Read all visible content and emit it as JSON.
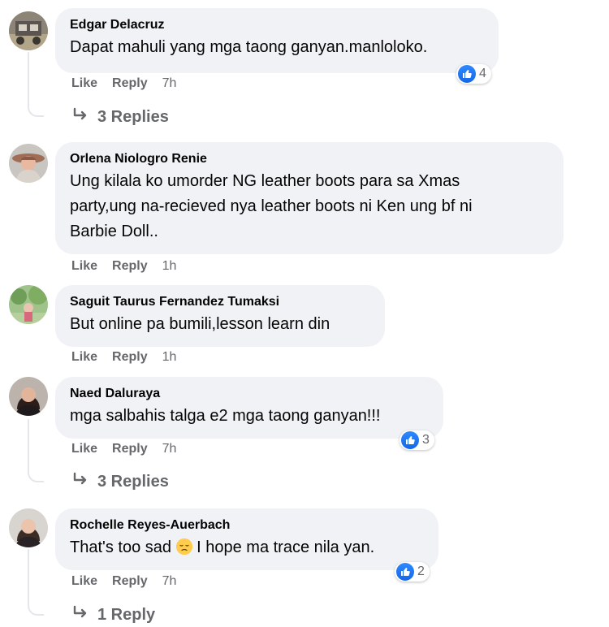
{
  "comments": [
    {
      "author": "Edgar Delacruz",
      "text": "Dapat mahuli yang mga taong ganyan.manloloko.",
      "like": "Like",
      "reply": "Reply",
      "time": "7h",
      "reaction_count": "4",
      "replies_label": "3 Replies"
    },
    {
      "author": "Orlena Niologro Renie",
      "text_lines": [
        "Ung kilala ko umorder NG leather boots para sa Xmas",
        "party,ung na-recieved nya leather boots ni Ken ung bf ni",
        "Barbie Doll.."
      ],
      "like": "Like",
      "reply": "Reply",
      "time": "1h"
    },
    {
      "author": "Saguit Taurus Fernandez Tumaksi",
      "text": "But online pa bumili,lesson learn din",
      "like": "Like",
      "reply": "Reply",
      "time": "1h"
    },
    {
      "author": "Naed Daluraya",
      "text": "mga salbahis talga e2 mga taong ganyan!!!",
      "like": "Like",
      "reply": "Reply",
      "time": "7h",
      "reaction_count": "3",
      "replies_label": "3 Replies"
    },
    {
      "author": "Rochelle Reyes-Auerbach",
      "text_before_emoji": "That's too sad ",
      "emoji_icon": "pensive-face-emoji",
      "text_after_emoji": " I hope ma trace nila yan.",
      "like": "Like",
      "reply": "Reply",
      "time": "7h",
      "reaction_count": "2",
      "replies_label": "1 Reply"
    }
  ],
  "colors": {
    "bubble": "#f0f2f5",
    "secondary_text": "#65676b",
    "like_blue": "#1877f2"
  }
}
